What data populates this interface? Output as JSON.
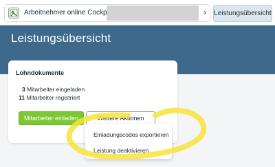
{
  "topbar": {
    "breadcrumb_label": "Arbeitnehmer online Cockpit",
    "chevron": "›",
    "leistung_button": "Leistungsübersicht",
    "app_icon": "app-icon"
  },
  "header": {
    "title": "Leistungsübersicht"
  },
  "card": {
    "title": "Lohndokumente",
    "stats": [
      {
        "count": "3",
        "label": "Mitarbeiter eingeladen"
      },
      {
        "count": "11",
        "label": "Mitarbeiter registriert"
      }
    ],
    "invite_button": "Mitarbeiter einladen",
    "more_actions_button": "Weitere Aktionen"
  },
  "dropdown": {
    "items": [
      {
        "label": "Einladungscodes exportieren"
      },
      {
        "label": "Leistung deaktivieren"
      }
    ]
  },
  "colors": {
    "header_bg": "#3d6a8c",
    "accent_green": "#7bc832",
    "highlight_yellow": "#f7e43a"
  }
}
